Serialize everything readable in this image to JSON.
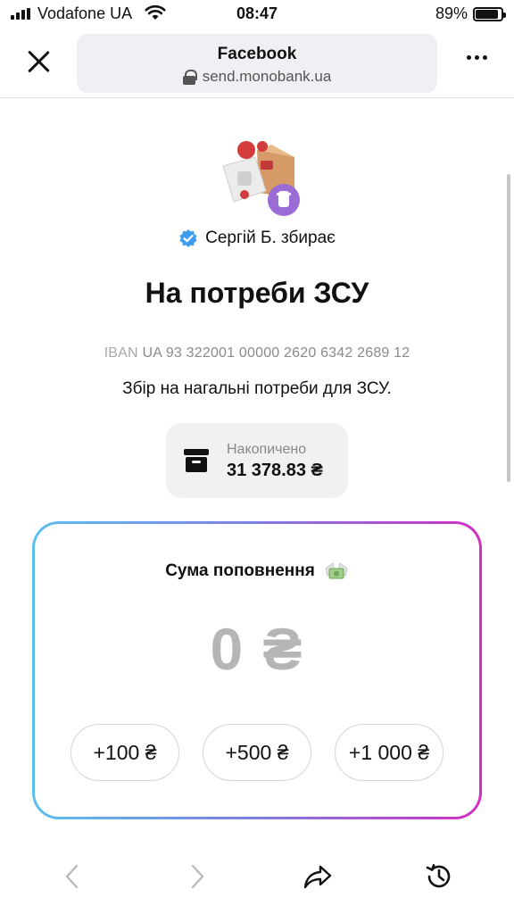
{
  "status_bar": {
    "carrier": "Vodafone UA",
    "time": "08:47",
    "battery_percent": "89%",
    "battery_level": 0.89
  },
  "browser": {
    "page_title": "Facebook",
    "url": "send.monobank.ua"
  },
  "jar": {
    "collector": "Сергій Б. збирає",
    "title": "На потреби ЗСУ",
    "iban_label": "IBAN",
    "iban": "UA 93 322001 00000 2620 6342 2689 12",
    "description": "Збір на нагальні потреби для ЗСУ.",
    "accumulated_label": "Накопичено",
    "accumulated_value": "31 378.83 ₴"
  },
  "amount": {
    "label": "Сума поповнення",
    "value": "0 ₴",
    "presets": [
      "+100 ₴",
      "+500 ₴",
      "+1 000 ₴"
    ]
  },
  "colors": {
    "gradient_start": "#5cc0ef",
    "gradient_end": "#d22fc3",
    "verified": "#3e9df0",
    "jar_badge": "#9b6bd6"
  },
  "icons": {
    "close": "close-icon",
    "more": "more-icon",
    "lock": "lock-icon",
    "verified": "verified-badge-icon",
    "accumulated": "archive-box-icon",
    "money": "money-wings-icon",
    "back": "back-arrow-icon",
    "forward": "forward-arrow-icon",
    "share": "share-icon",
    "history": "history-icon"
  }
}
